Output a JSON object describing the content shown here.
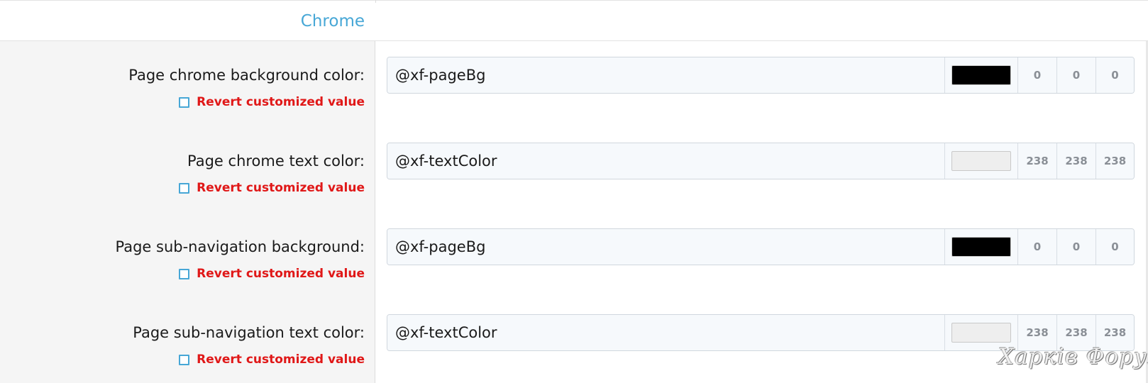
{
  "section": {
    "title": "Chrome"
  },
  "common": {
    "revert_label": "Revert customized value"
  },
  "rows": [
    {
      "label": "Page chrome background color:",
      "value": "@xf-pageBg",
      "swatch_color": "#000000",
      "r": "0",
      "g": "0",
      "b": "0"
    },
    {
      "label": "Page chrome text color:",
      "value": "@xf-textColor",
      "swatch_color": "#eeeeee",
      "r": "238",
      "g": "238",
      "b": "238"
    },
    {
      "label": "Page sub-navigation background:",
      "value": "@xf-pageBg",
      "swatch_color": "#000000",
      "r": "0",
      "g": "0",
      "b": "0"
    },
    {
      "label": "Page sub-navigation text color:",
      "value": "@xf-textColor",
      "swatch_color": "#eeeeee",
      "r": "238",
      "g": "238",
      "b": "238"
    }
  ],
  "watermark": {
    "text": "Харків Форум"
  },
  "colors": {
    "accent": "#47a7d6",
    "revert": "#e01818",
    "label_bg": "#f5f5f5",
    "field_bg": "#f6f9fc"
  }
}
